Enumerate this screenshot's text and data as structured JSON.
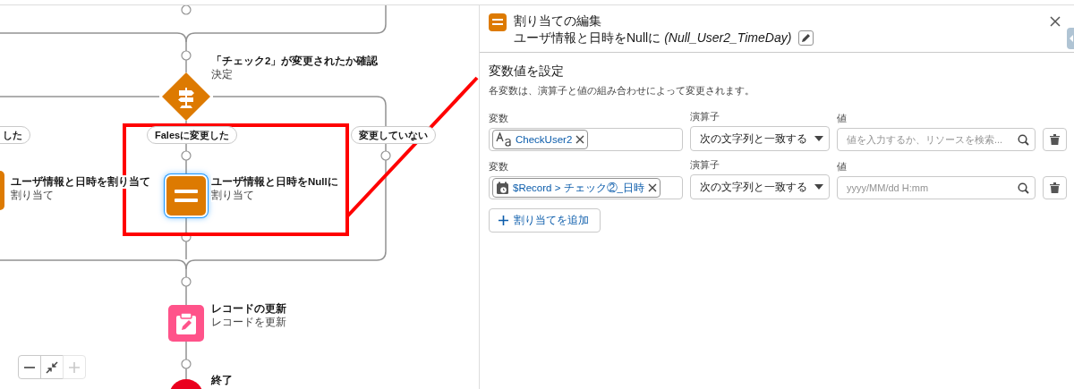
{
  "canvas": {
    "nodes": [
      {
        "kind": "decision",
        "title": "「チェック2」が変更されたか確認",
        "subtitle": "決定",
        "selected": false
      },
      {
        "kind": "assignment",
        "title": "ユーザ情報と日時を割り当て",
        "subtitle": "割り当て",
        "selected": false
      },
      {
        "kind": "assignment",
        "title": "ユーザ情報と日時をNullに",
        "subtitle": "割り当て",
        "selected": true
      },
      {
        "kind": "update",
        "title": "レコードの更新",
        "subtitle": "レコードを更新",
        "selected": false
      },
      {
        "kind": "end",
        "title": "終了",
        "selected": false
      }
    ],
    "branch_labels": [
      "した",
      "Falesに変更した",
      "変更していない"
    ],
    "zoom_controls": [
      {
        "kind": "zoom_out",
        "disabled": false
      },
      {
        "kind": "fit",
        "disabled": false
      },
      {
        "kind": "zoom_in",
        "disabled": true
      }
    ]
  },
  "panel": {
    "title": "割り当ての編集",
    "subtitle": "ユーザ情報と日時をNullに",
    "api_name": "(Null_User2_TimeDay)",
    "section_title": "変数値を設定",
    "description": "各変数は、演算子と値の組み合わせによって変更されます。",
    "assignments": [
      {
        "variable_label": "変数",
        "operator_label": "演算子",
        "value_label": "値",
        "variable": {
          "kind": "text",
          "name": "CheckUser2"
        },
        "operator": "次の文字列と一致する",
        "value_placeholder": "値を入力するか、リソースを検索..."
      },
      {
        "variable_label": "変数",
        "operator_label": "演算子",
        "value_label": "値",
        "variable": {
          "kind": "datetime",
          "name": "$Record > チェック②_日時"
        },
        "operator": "次の文字列と一致する",
        "value_placeholder": "yyyy/MM/dd H:mm"
      }
    ],
    "add_button": "割り当てを追加"
  }
}
